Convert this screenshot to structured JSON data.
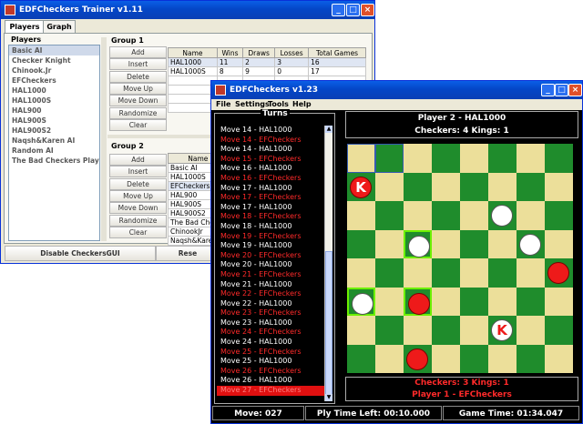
{
  "trainer": {
    "title": "EDFCheckers Trainer v1.11",
    "tabs": [
      "Players",
      "Graph"
    ],
    "players_label": "Players",
    "players": [
      "Basic AI",
      "Checker Knight",
      "Chinook.Jr",
      "EFCheckers",
      "HAL1000",
      "HAL1000S",
      "HAL900",
      "HAL900S",
      "HAL900S2",
      "Naqsh&Karen AI",
      "Random AI",
      "The Bad Checkers Player"
    ],
    "group1": {
      "label": "Group 1",
      "buttons": [
        "Add",
        "Insert",
        "Delete",
        "Move Up",
        "Move Down",
        "Randomize",
        "Clear"
      ],
      "columns": [
        "Name",
        "Wins",
        "Draws",
        "Losses",
        "Total Games"
      ],
      "rows": [
        [
          "HAL1000",
          "11",
          "2",
          "3",
          "16"
        ],
        [
          "HAL1000S",
          "8",
          "9",
          "0",
          "17"
        ]
      ]
    },
    "group2": {
      "label": "Group 2",
      "buttons": [
        "Add",
        "Insert",
        "Delete",
        "Move Up",
        "Move Down",
        "Randomize",
        "Clear"
      ],
      "column": "Name",
      "names": [
        "Basic AI",
        "HAL1000S",
        "EFCheckers",
        "HAL900",
        "HAL900S",
        "HAL900S2",
        "The Bad Checke",
        "ChinookJr",
        "Naqsh&Karen"
      ]
    },
    "disable_button": "Disable CheckersGUI",
    "reset_button": "Rese"
  },
  "game": {
    "title": "EDFCheckers v1.23",
    "menu": [
      "File",
      "Settings",
      "Tools",
      "Help"
    ],
    "turns_label": "Turns",
    "turns": [
      "Move 14 - HAL1000",
      "Move 14 - EFCheckers",
      "Move 14 - HAL1000",
      "Move 15 - EFCheckers",
      "Move 16 - HAL1000",
      "Move 16 - EFCheckers",
      "Move 17 - HAL1000",
      "Move 17 - EFCheckers",
      "Move 17 - HAL1000",
      "Move 18 - EFCheckers",
      "Move 18 - HAL1000",
      "Move 19 - EFCheckers",
      "Move 19 - HAL1000",
      "Move 20 - EFCheckers",
      "Move 20 - HAL1000",
      "Move 21 - EFCheckers",
      "Move 21 - HAL1000",
      "Move 22 - EFCheckers",
      "Move 22 - HAL1000",
      "Move 23 - EFCheckers",
      "Move 23 - HAL1000",
      "Move 24 - EFCheckers",
      "Move 24 - HAL1000",
      "Move 25 - EFCheckers",
      "Move 25 - HAL1000",
      "Move 26 - EFCheckers",
      "Move 26 - HAL1000",
      "Move 27 - EFCheckers"
    ],
    "player2": {
      "name": "Player 2 - HAL1000",
      "stats": "Checkers: 4   Kings: 1"
    },
    "player1": {
      "name": "Player 1 - EFCheckers",
      "stats": "Checkers: 3   Kings: 1"
    },
    "status": {
      "move": "Move: 027",
      "ply_time": "Ply Time Left: 00:10.000",
      "game_time": "Game Time: 01:34.047"
    },
    "colors": {
      "dark_square": "#1f8c2c",
      "light_square": "#ecdf9a",
      "player1": "#ff2a2a",
      "player2": "#ffffff",
      "panel": "#000000"
    },
    "pieces": [
      {
        "row": 1,
        "col": 0,
        "color": "red",
        "king": true,
        "label": "K"
      },
      {
        "row": 2,
        "col": 5,
        "color": "white",
        "king": false,
        "label": ""
      },
      {
        "row": 3,
        "col": 2,
        "color": "white",
        "king": false,
        "label": ""
      },
      {
        "row": 3,
        "col": 6,
        "color": "white",
        "king": false,
        "label": ""
      },
      {
        "row": 4,
        "col": 7,
        "color": "red",
        "king": false,
        "label": ""
      },
      {
        "row": 5,
        "col": 0,
        "color": "white",
        "king": false,
        "label": ""
      },
      {
        "row": 5,
        "col": 2,
        "color": "red",
        "king": false,
        "label": ""
      },
      {
        "row": 6,
        "col": 5,
        "color": "white",
        "king": true,
        "label": "K"
      },
      {
        "row": 7,
        "col": 2,
        "color": "red",
        "king": false,
        "label": ""
      }
    ],
    "highlighted_squares": [
      [
        5,
        0
      ],
      [
        3,
        2
      ],
      [
        5,
        2
      ]
    ],
    "selected_squares": [
      [
        0,
        0
      ],
      [
        0,
        1
      ]
    ]
  }
}
